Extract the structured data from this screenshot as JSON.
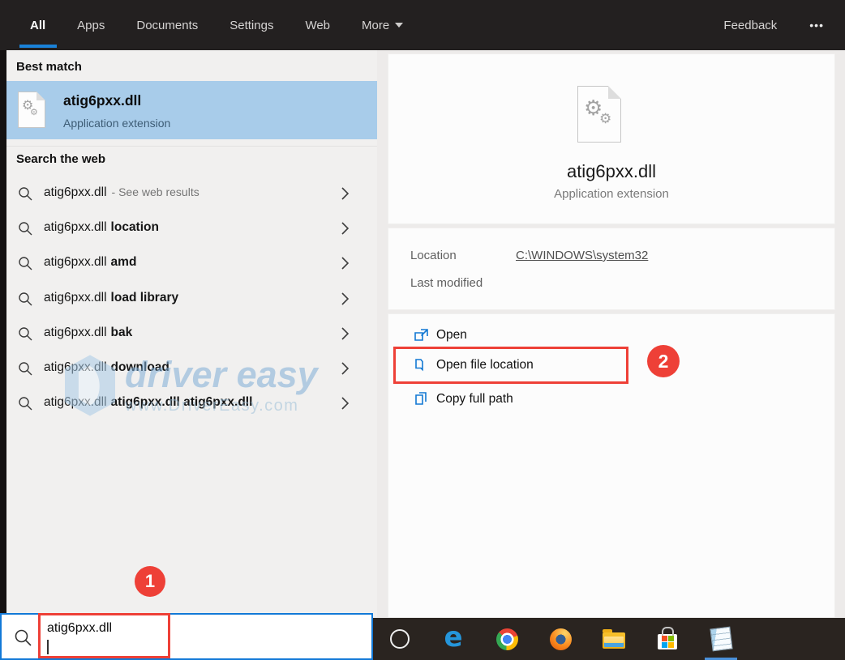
{
  "topbar": {
    "tabs": {
      "all": "All",
      "apps": "Apps",
      "documents": "Documents",
      "settings": "Settings",
      "web": "Web",
      "more": "More"
    },
    "feedback": "Feedback",
    "ellipsis": "•••"
  },
  "left_panel": {
    "best_match_header": "Best match",
    "best_match": {
      "title": "atig6pxx.dll",
      "subtitle": "Application extension"
    },
    "search_web_header": "Search the web",
    "suggestions": [
      {
        "text": "atig6pxx.dll",
        "bold": "",
        "note": "- See web results"
      },
      {
        "text": "atig6pxx.dll",
        "bold": "location",
        "note": ""
      },
      {
        "text": "atig6pxx.dll",
        "bold": "amd",
        "note": ""
      },
      {
        "text": "atig6pxx.dll",
        "bold": "load library",
        "note": ""
      },
      {
        "text": "atig6pxx.dll",
        "bold": "bak",
        "note": ""
      },
      {
        "text": "atig6pxx.dll",
        "bold": "download",
        "note": ""
      },
      {
        "text": "atig6pxx.dll",
        "bold": "atig6pxx.dll atig6pxx.dll",
        "note": ""
      }
    ]
  },
  "preview": {
    "title": "atig6pxx.dll",
    "subtitle": "Application extension",
    "location_label": "Location",
    "location_value": "C:\\WINDOWS\\system32",
    "modified_label": "Last modified",
    "modified_value": "",
    "actions": {
      "open": "Open",
      "open_file_location": "Open file location",
      "copy_full_path": "Copy full path"
    }
  },
  "search": {
    "value": "atig6pxx.dll"
  },
  "annotations": {
    "step1": "1",
    "step2": "2",
    "color": "#ee4037"
  },
  "watermark": {
    "line1": "driver easy",
    "line2": "www.DriverEasy.com"
  },
  "colors": {
    "accent_blue": "#1a82d8",
    "highlight_blue": "#a8ccea",
    "action_icon_blue": "#1278d3",
    "taskbar_bg": "#2a2420"
  },
  "icons": {
    "gear": "⚙",
    "edge_glyph": "e"
  }
}
